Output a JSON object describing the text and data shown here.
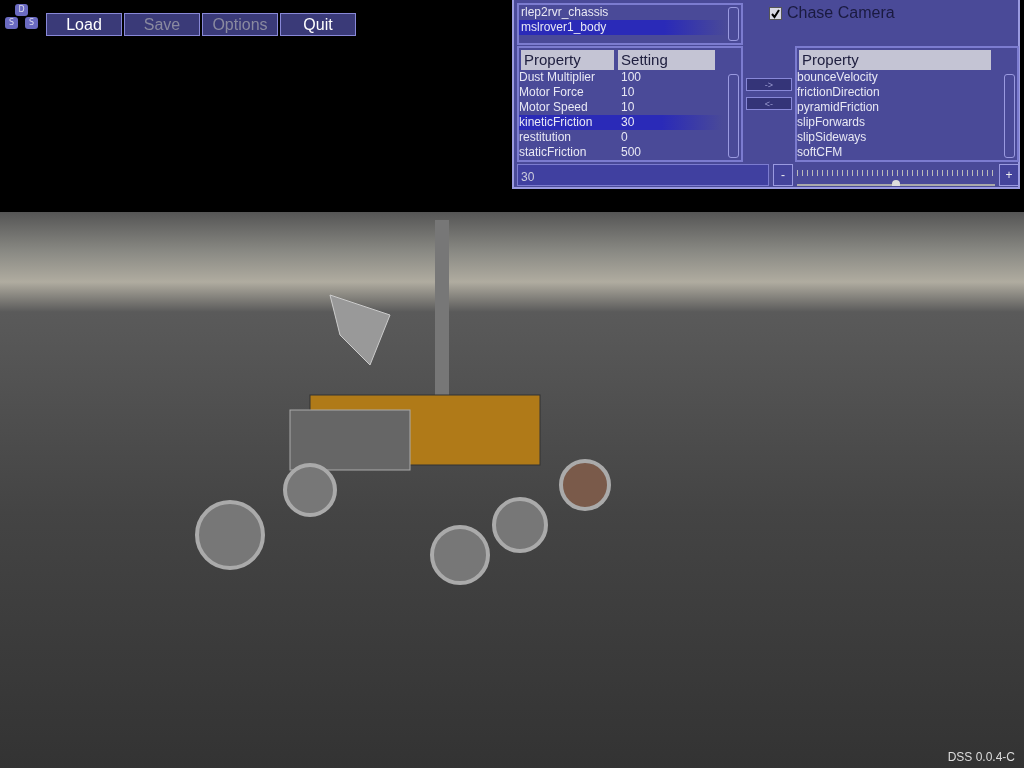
{
  "logo": {
    "letters": [
      "D",
      "S",
      "S"
    ]
  },
  "menu": [
    {
      "label": "Load",
      "disabled": false
    },
    {
      "label": "Save",
      "disabled": true
    },
    {
      "label": "Options",
      "disabled": true
    },
    {
      "label": "Quit",
      "disabled": false
    }
  ],
  "panel": {
    "bodies": [
      {
        "name": "rlep2rvr_chassis",
        "selected": false
      },
      {
        "name": "mslrover1_body",
        "selected": true
      }
    ],
    "chase_camera": {
      "label": "Chase Camera",
      "checked": true
    },
    "properties": {
      "columns": [
        "Property",
        "Setting"
      ],
      "rows": [
        {
          "property": "Dust Multiplier",
          "setting": "100",
          "selected": false
        },
        {
          "property": "Motor Force",
          "setting": "10",
          "selected": false
        },
        {
          "property": "Motor Speed",
          "setting": "10",
          "selected": false
        },
        {
          "property": "kineticFriction",
          "setting": "30",
          "selected": true
        },
        {
          "property": "restitution",
          "setting": "0",
          "selected": false
        },
        {
          "property": "staticFriction",
          "setting": "500",
          "selected": false
        }
      ]
    },
    "move_buttons": [
      "->",
      "<-"
    ],
    "available": {
      "columns": [
        "Property"
      ],
      "rows": [
        {
          "property": "bounceVelocity",
          "selected": false
        },
        {
          "property": "frictionDirection",
          "selected": false
        },
        {
          "property": "pyramidFriction",
          "selected": false
        },
        {
          "property": "slipForwards",
          "selected": false
        },
        {
          "property": "slipSideways",
          "selected": false
        },
        {
          "property": "softCFM",
          "selected": false
        }
      ]
    },
    "value_field": {
      "value": "30"
    },
    "decrement": "-",
    "increment": "+",
    "slider": {
      "level": 0.5
    }
  },
  "version": "DSS 0.0.4-C"
}
